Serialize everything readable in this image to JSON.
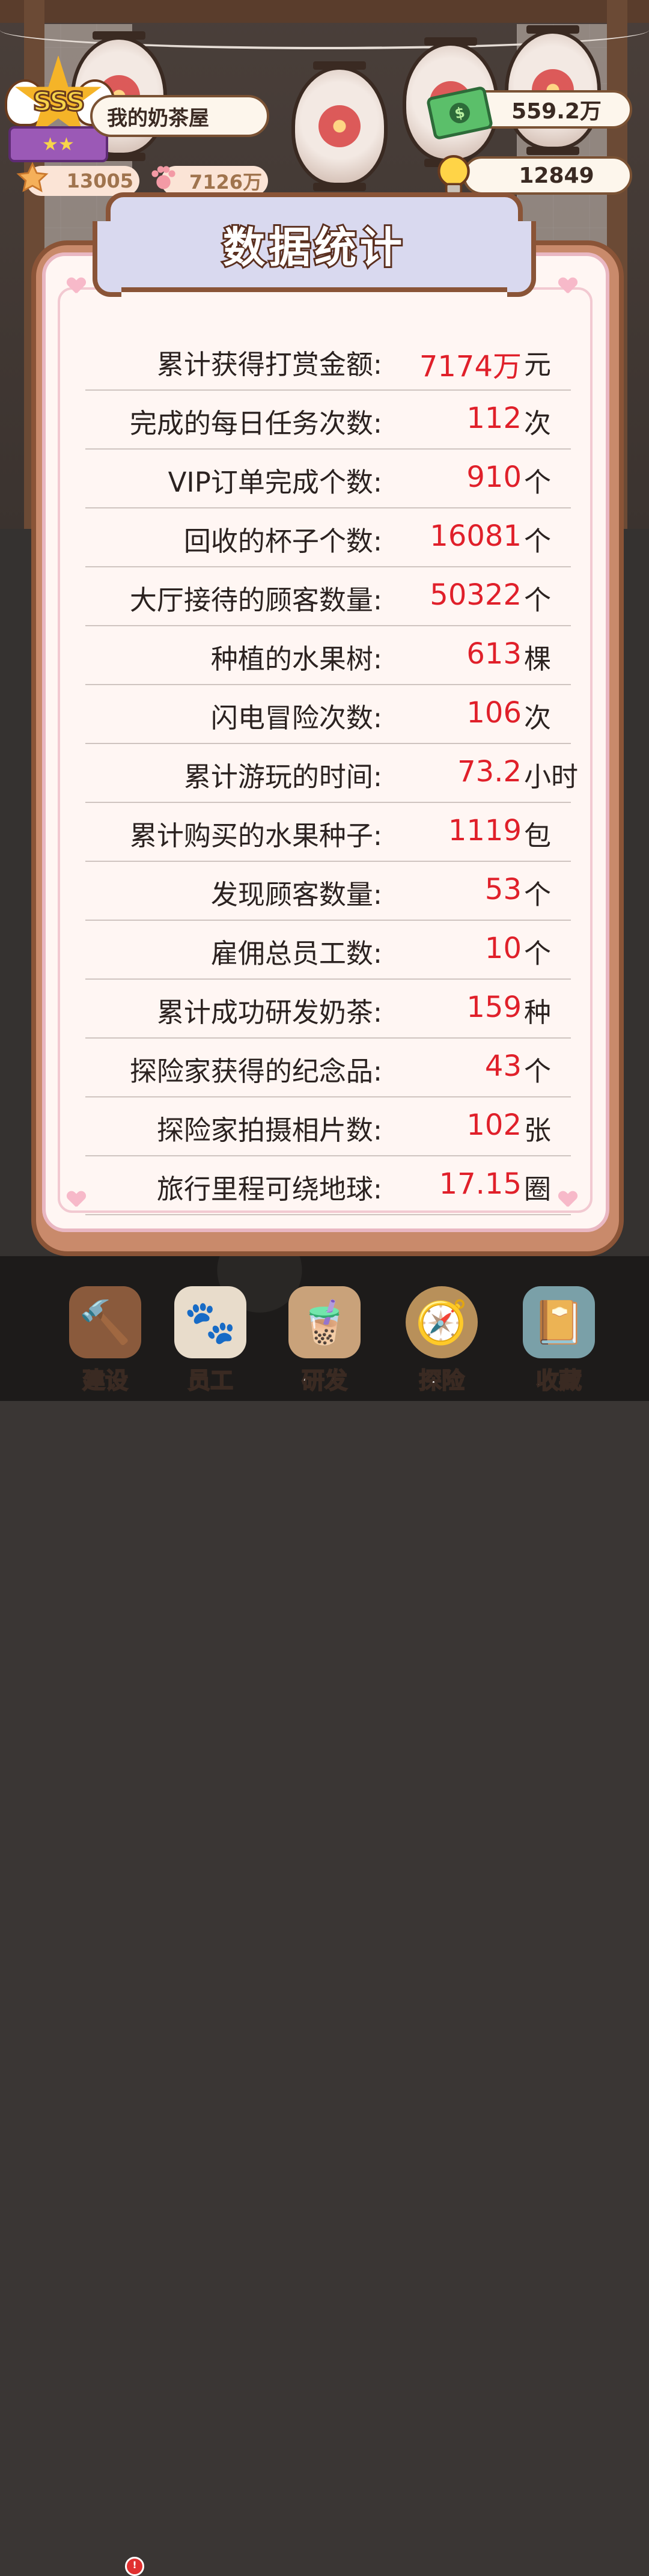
{
  "header": {
    "badge_rank": "SSS",
    "badge_stars": "★★",
    "shop_name": "我的奶茶屋",
    "star_count": "13005",
    "paw_count": "7126万",
    "money": "559.2万",
    "ideas": "12849"
  },
  "panel": {
    "title": "数据统计",
    "rows": [
      {
        "label": "累计获得打赏金额:",
        "value": "7174万",
        "unit": "元"
      },
      {
        "label": "完成的每日任务次数:",
        "value": "112",
        "unit": "次"
      },
      {
        "label": "VIP订单完成个数:",
        "value": "910",
        "unit": "个"
      },
      {
        "label": "回收的杯子个数:",
        "value": "16081",
        "unit": "个"
      },
      {
        "label": "大厅接待的顾客数量:",
        "value": "50322",
        "unit": "个"
      },
      {
        "label": "种植的水果树:",
        "value": "613",
        "unit": "棵"
      },
      {
        "label": "闪电冒险次数:",
        "value": "106",
        "unit": "次"
      },
      {
        "label": "累计游玩的时间:",
        "value": "73.2",
        "unit": "小时"
      },
      {
        "label": "累计购买的水果种子:",
        "value": "1119",
        "unit": "包"
      },
      {
        "label": "发现顾客数量:",
        "value": "53",
        "unit": "个"
      },
      {
        "label": "雇佣总员工数:",
        "value": "10",
        "unit": "个"
      },
      {
        "label": "累计成功研发奶茶:",
        "value": "159",
        "unit": "种"
      },
      {
        "label": "探险家获得的纪念品:",
        "value": "43",
        "unit": "个"
      },
      {
        "label": "探险家拍摄相片数:",
        "value": "102",
        "unit": "张"
      },
      {
        "label": "旅行里程可绕地球:",
        "value": "17.15",
        "unit": "圈"
      }
    ]
  },
  "nav": {
    "items": [
      {
        "label": "建设",
        "icon": "hammer-icon"
      },
      {
        "label": "员工",
        "icon": "cat-paw-icon"
      },
      {
        "label": "研发",
        "icon": "milk-tea-icon"
      },
      {
        "label": "探险",
        "icon": "compass-icon"
      },
      {
        "label": "收藏",
        "icon": "book-icon"
      }
    ]
  },
  "colors": {
    "value_red": "#e0202a",
    "panel_border": "#8a5437",
    "paper": "#fff6f3"
  }
}
